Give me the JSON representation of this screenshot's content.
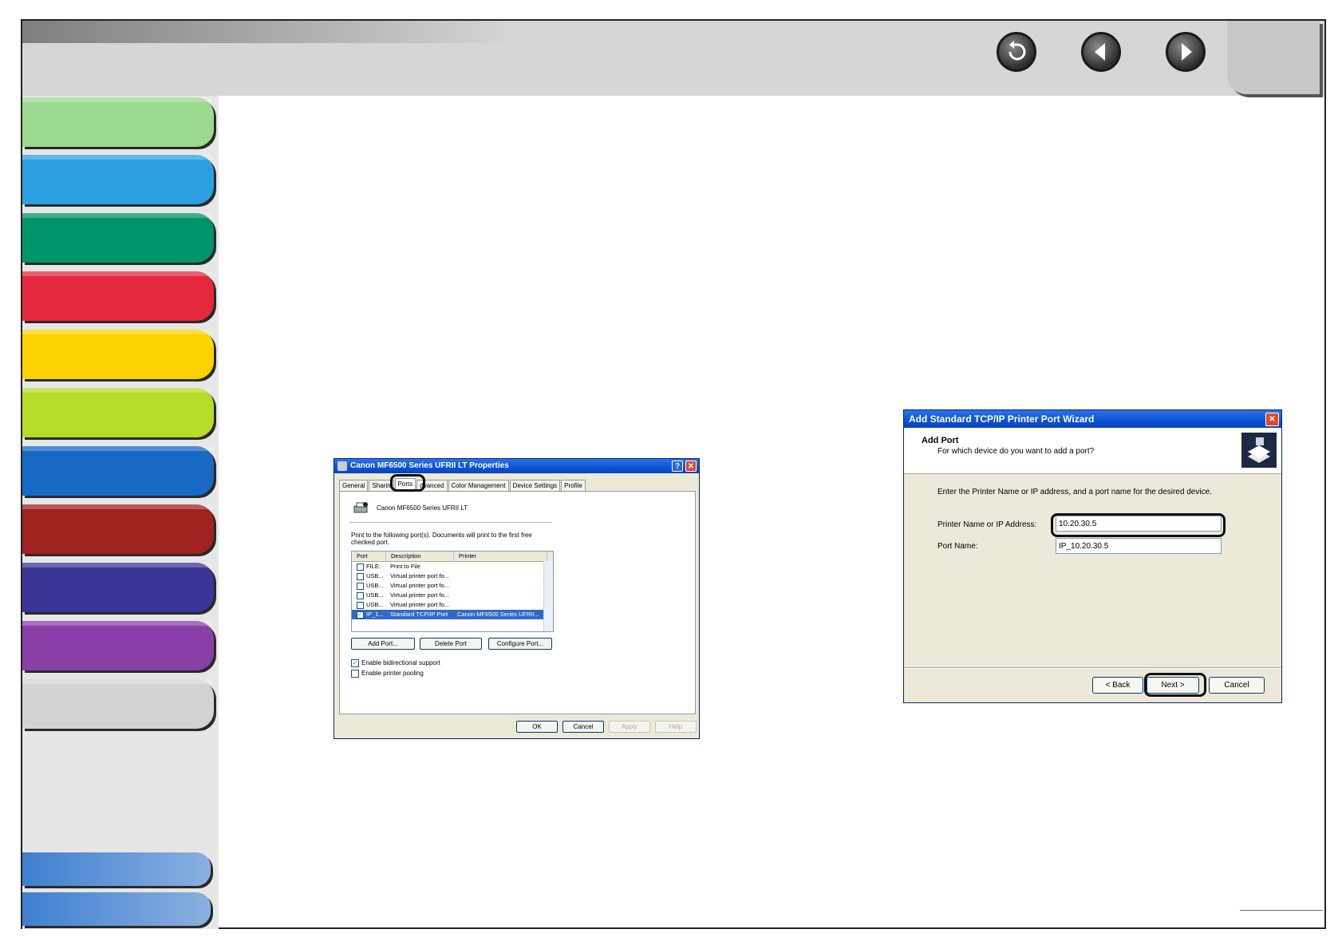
{
  "nav": {
    "back_icon": "return-icon",
    "prev_icon": "previous-page-icon",
    "next_icon": "next-page-icon"
  },
  "sidebar": {
    "tabs": [
      {
        "color": "#9bd98e"
      },
      {
        "color": "#2b9fe0"
      },
      {
        "color": "#00946a"
      },
      {
        "color": "#e3283c"
      },
      {
        "color": "#fdd200"
      },
      {
        "color": "#b6dc2a"
      },
      {
        "color": "#1769c4"
      },
      {
        "color": "#a0221f"
      },
      {
        "color": "#3a3596"
      },
      {
        "color": "#8a3fa8"
      },
      {
        "color": "#d3d3d3"
      }
    ]
  },
  "properties_dialog": {
    "title": "Canon MF6500 Series UFRII LT Properties",
    "tabs": [
      "General",
      "Sharin",
      "Ports",
      "dvanced",
      "Color Management",
      "Device Settings",
      "Profile"
    ],
    "printer_name": "Canon MF6500 Series UFRII LT",
    "instruction": "Print to the following port(s). Documents will print to the first free checked port.",
    "columns": [
      "Port",
      "Description",
      "Printer"
    ],
    "ports": [
      {
        "port": "FILE:",
        "description": "Print to File",
        "printer": "",
        "checked": false,
        "selected": false
      },
      {
        "port": "USB...",
        "description": "Virtual printer port fo...",
        "printer": "",
        "checked": false,
        "selected": false
      },
      {
        "port": "USB...",
        "description": "Virtual printer port fo...",
        "printer": "",
        "checked": false,
        "selected": false
      },
      {
        "port": "USB...",
        "description": "Virtual printer port fo...",
        "printer": "",
        "checked": false,
        "selected": false
      },
      {
        "port": "USB...",
        "description": "Virtual printer port fo...",
        "printer": "",
        "checked": false,
        "selected": false
      },
      {
        "port": "IP_1...",
        "description": "Standard TCP/IP Port",
        "printer": "Canon MF6500 Series UFRII...",
        "checked": true,
        "selected": true
      }
    ],
    "add_port": "Add Port...",
    "delete_port": "Delete Port",
    "configure_port": "Configure Port...",
    "bidirectional": "Enable bidirectional support",
    "pooling": "Enable printer pooling",
    "ok": "OK",
    "cancel": "Cancel",
    "apply": "Apply",
    "help": "Help",
    "help_glyph": "?",
    "close_glyph": "✕"
  },
  "wizard": {
    "title": "Add Standard TCP/IP Printer Port Wizard",
    "heading": "Add Port",
    "subheading": "For which device do you want to add a port?",
    "instruction": "Enter the Printer Name or IP address, and a port name for the desired device.",
    "ip_label": "Printer Name or IP Address:",
    "ip_value": "10.20.30.5",
    "port_label": "Port Name:",
    "port_value": "IP_10.20.30.5",
    "back": "< Back",
    "next": "Next >",
    "cancel": "Cancel",
    "close_glyph": "✕"
  }
}
